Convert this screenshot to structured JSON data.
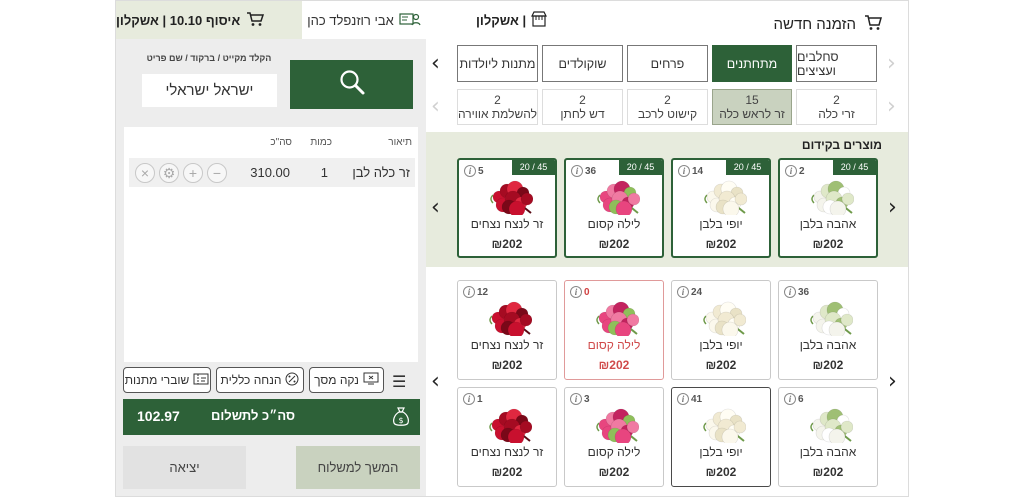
{
  "header": {
    "pickup_label": "איסוף 10.10 | אשקלון",
    "customer_name": "אבי רוזנפלד כהן",
    "branch": "| אשקלון",
    "new_order": "הזמנה חדשה"
  },
  "search": {
    "label": "הקלד מקייט / ברקוד / שם פריט",
    "value": "ישראל ישראלי"
  },
  "cart": {
    "headers": {
      "description": "תיאור",
      "quantity": "כמות",
      "total": "סה\"כ"
    },
    "rows": [
      {
        "description": "זר כלה לבן",
        "quantity": "1",
        "total": "310.00"
      }
    ]
  },
  "actions": {
    "screen_clear": "נקה מסך",
    "general_discount": "הנחה כללית",
    "gift_vouchers": "שוברי מתנות"
  },
  "payment": {
    "total_label": "סה״כ לתשלום",
    "total_amount": "102.97"
  },
  "buttons": {
    "continue_delivery": "המשך למשלוח",
    "exit": "יציאה"
  },
  "categories": [
    {
      "label": "סחלבים ועציצים",
      "active": false
    },
    {
      "label": "מתחתנים",
      "active": true
    },
    {
      "label": "פרחים",
      "active": false
    },
    {
      "label": "שוקולדים",
      "active": false
    },
    {
      "label": "מתנות ליולדות",
      "active": false
    }
  ],
  "subcategories": [
    {
      "count": "2",
      "label": "זרי כלה",
      "active": false
    },
    {
      "count": "15",
      "label": "זר לראש כלה",
      "active": true
    },
    {
      "count": "2",
      "label": "קישוט לרכב",
      "active": false
    },
    {
      "count": "2",
      "label": "דש לחתן",
      "active": false
    },
    {
      "count": "2",
      "label": "להשלמת אווירה",
      "active": false
    }
  ],
  "featured": {
    "title": "מוצרים בקידום",
    "items": [
      {
        "name": "אהבה בלבן",
        "price": "₪202",
        "qty": "2",
        "badge": "20 / 45",
        "flower": "white-green"
      },
      {
        "name": "יופי בלבן",
        "price": "₪202",
        "qty": "14",
        "badge": "20 / 45",
        "flower": "white"
      },
      {
        "name": "לילה קסום",
        "price": "₪202",
        "qty": "36",
        "badge": "20 / 45",
        "flower": "pink"
      },
      {
        "name": "זר לנצח נצחים",
        "price": "₪202",
        "qty": "5",
        "badge": "20 / 45",
        "flower": "red"
      }
    ]
  },
  "grid": [
    {
      "name": "אהבה בלבן",
      "price": "₪202",
      "qty": "36",
      "flower": "white-green",
      "state": "normal"
    },
    {
      "name": "יופי בלבן",
      "price": "₪202",
      "qty": "24",
      "flower": "white",
      "state": "normal"
    },
    {
      "name": "לילה קסום",
      "price": "₪202",
      "qty": "0",
      "flower": "pink",
      "state": "oos"
    },
    {
      "name": "זר לנצח נצחים",
      "price": "₪202",
      "qty": "12",
      "flower": "red",
      "state": "normal"
    },
    {
      "name": "אהבה בלבן",
      "price": "₪202",
      "qty": "6",
      "flower": "white-green",
      "state": "normal"
    },
    {
      "name": "יופי בלבן",
      "price": "₪202",
      "qty": "41",
      "flower": "white",
      "state": "selected"
    },
    {
      "name": "לילה קסום",
      "price": "₪202",
      "qty": "3",
      "flower": "pink",
      "state": "normal"
    },
    {
      "name": "זר לנצח נצחים",
      "price": "₪202",
      "qty": "1",
      "flower": "red",
      "state": "normal"
    }
  ],
  "colors": {
    "accent": "#2d6138",
    "accent_light": "#c9d2bf",
    "panel_bg": "#e7ebdd",
    "oos": "#d04a4a"
  },
  "icons": {
    "cart": "cart-icon",
    "customer": "customer-card-icon",
    "store": "store-icon",
    "search": "search-icon",
    "money_bag": "money-bag-icon"
  }
}
